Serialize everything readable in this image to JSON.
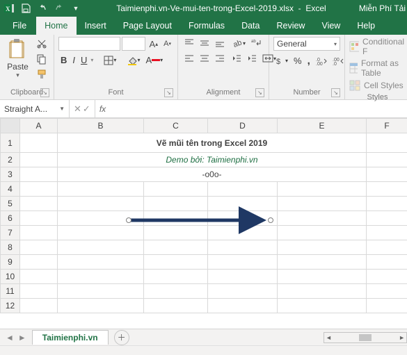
{
  "titlebar": {
    "filename": "Taimienphi.vn-Ve-mui-ten-trong-Excel-2019.xlsx",
    "app": "Excel",
    "right_text": "Miễn Phí Tải"
  },
  "tabs": {
    "file": "File",
    "home": "Home",
    "insert": "Insert",
    "pagelayout": "Page Layout",
    "formulas": "Formulas",
    "data": "Data",
    "review": "Review",
    "view": "View",
    "help": "Help"
  },
  "ribbon": {
    "clipboard": {
      "label": "Clipboard",
      "paste": "Paste"
    },
    "font": {
      "label": "Font"
    },
    "alignment": {
      "label": "Alignment"
    },
    "number": {
      "label": "Number",
      "format": "General"
    },
    "styles": {
      "label": "Styles",
      "cond": "Conditional F",
      "table": "Format as Table",
      "cell": "Cell Styles"
    }
  },
  "namebox": "Straight A...",
  "fx_label": "fx",
  "columns": [
    "A",
    "B",
    "C",
    "D",
    "E",
    "F"
  ],
  "rows": [
    "1",
    "2",
    "3",
    "4",
    "5",
    "6",
    "7",
    "8",
    "9",
    "10",
    "11",
    "12"
  ],
  "content": {
    "title": "Vẽ mũi tên trong Excel 2019",
    "demo": "Demo bởi: Taimienphi.vn",
    "ooo": "-o0o-"
  },
  "sheet": {
    "name": "Taimienphi.vn"
  }
}
